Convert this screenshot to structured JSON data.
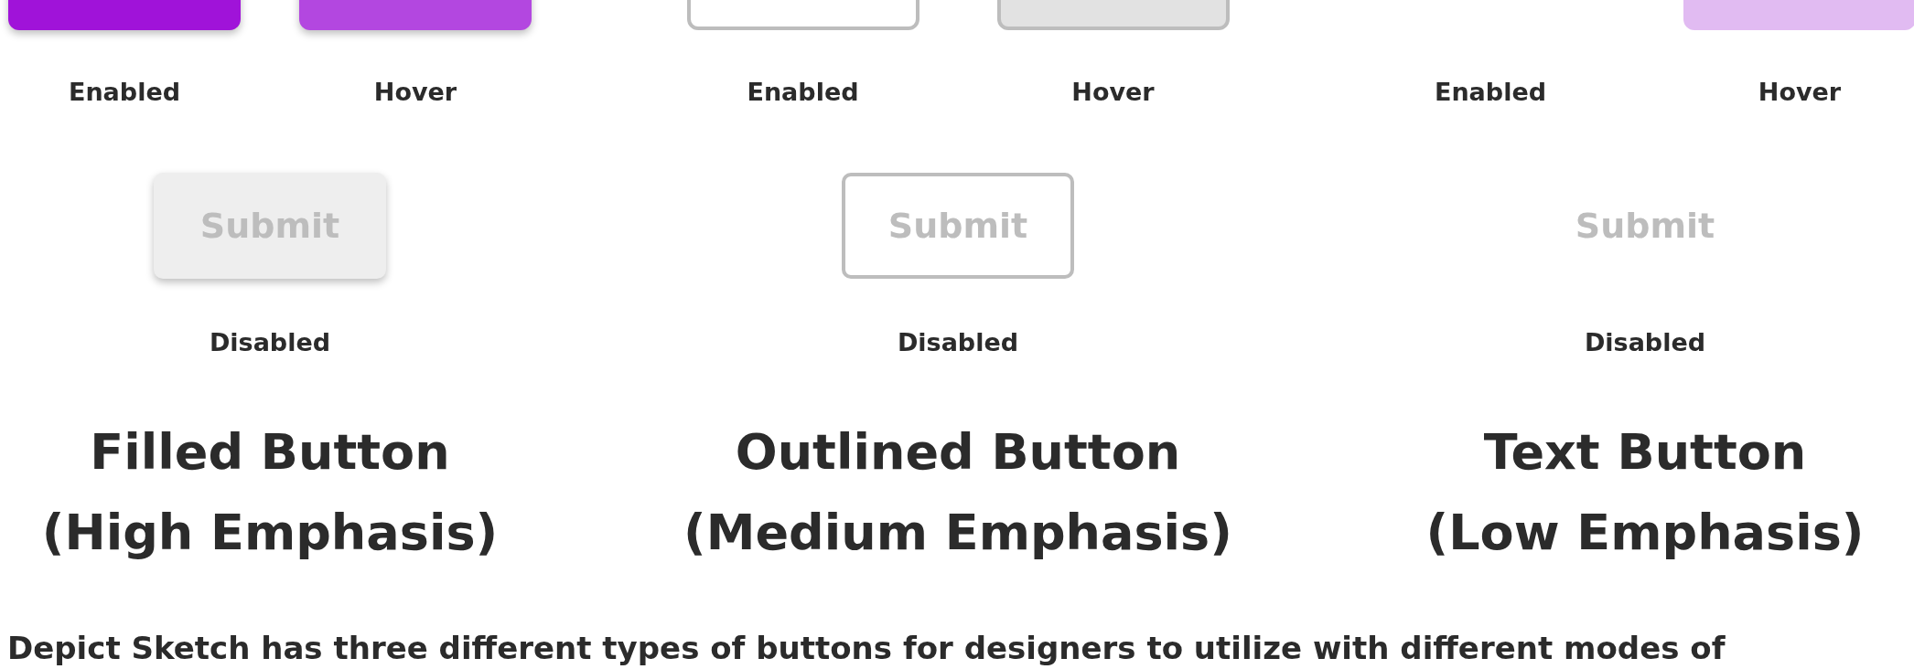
{
  "columns": [
    {
      "kind": "filled",
      "buttons": [
        {
          "hovered": false,
          "label": "Enabled"
        },
        {
          "hovered": true,
          "label": "Hover"
        }
      ],
      "disabled": {
        "text": "Submit",
        "label": "Disabled"
      },
      "title": "Filled Button",
      "subtitle": "(High Emphasis)"
    },
    {
      "kind": "outlined",
      "buttons": [
        {
          "hovered": false,
          "label": "Enabled"
        },
        {
          "hovered": true,
          "label": "Hover"
        }
      ],
      "disabled": {
        "text": "Submit",
        "label": "Disabled"
      },
      "title": "Outlined Button",
      "subtitle": "(Medium Emphasis)"
    },
    {
      "kind": "text",
      "buttons": [
        {
          "hovered": false,
          "label": "Enabled"
        },
        {
          "hovered": true,
          "label": "Hover"
        }
      ],
      "disabled": {
        "text": "Submit",
        "label": "Disabled"
      },
      "title": "Text Button",
      "subtitle": "(Low Emphasis)"
    }
  ],
  "caption": "Depict Sketch has three different types of buttons for designers to utilize with different modes of"
}
